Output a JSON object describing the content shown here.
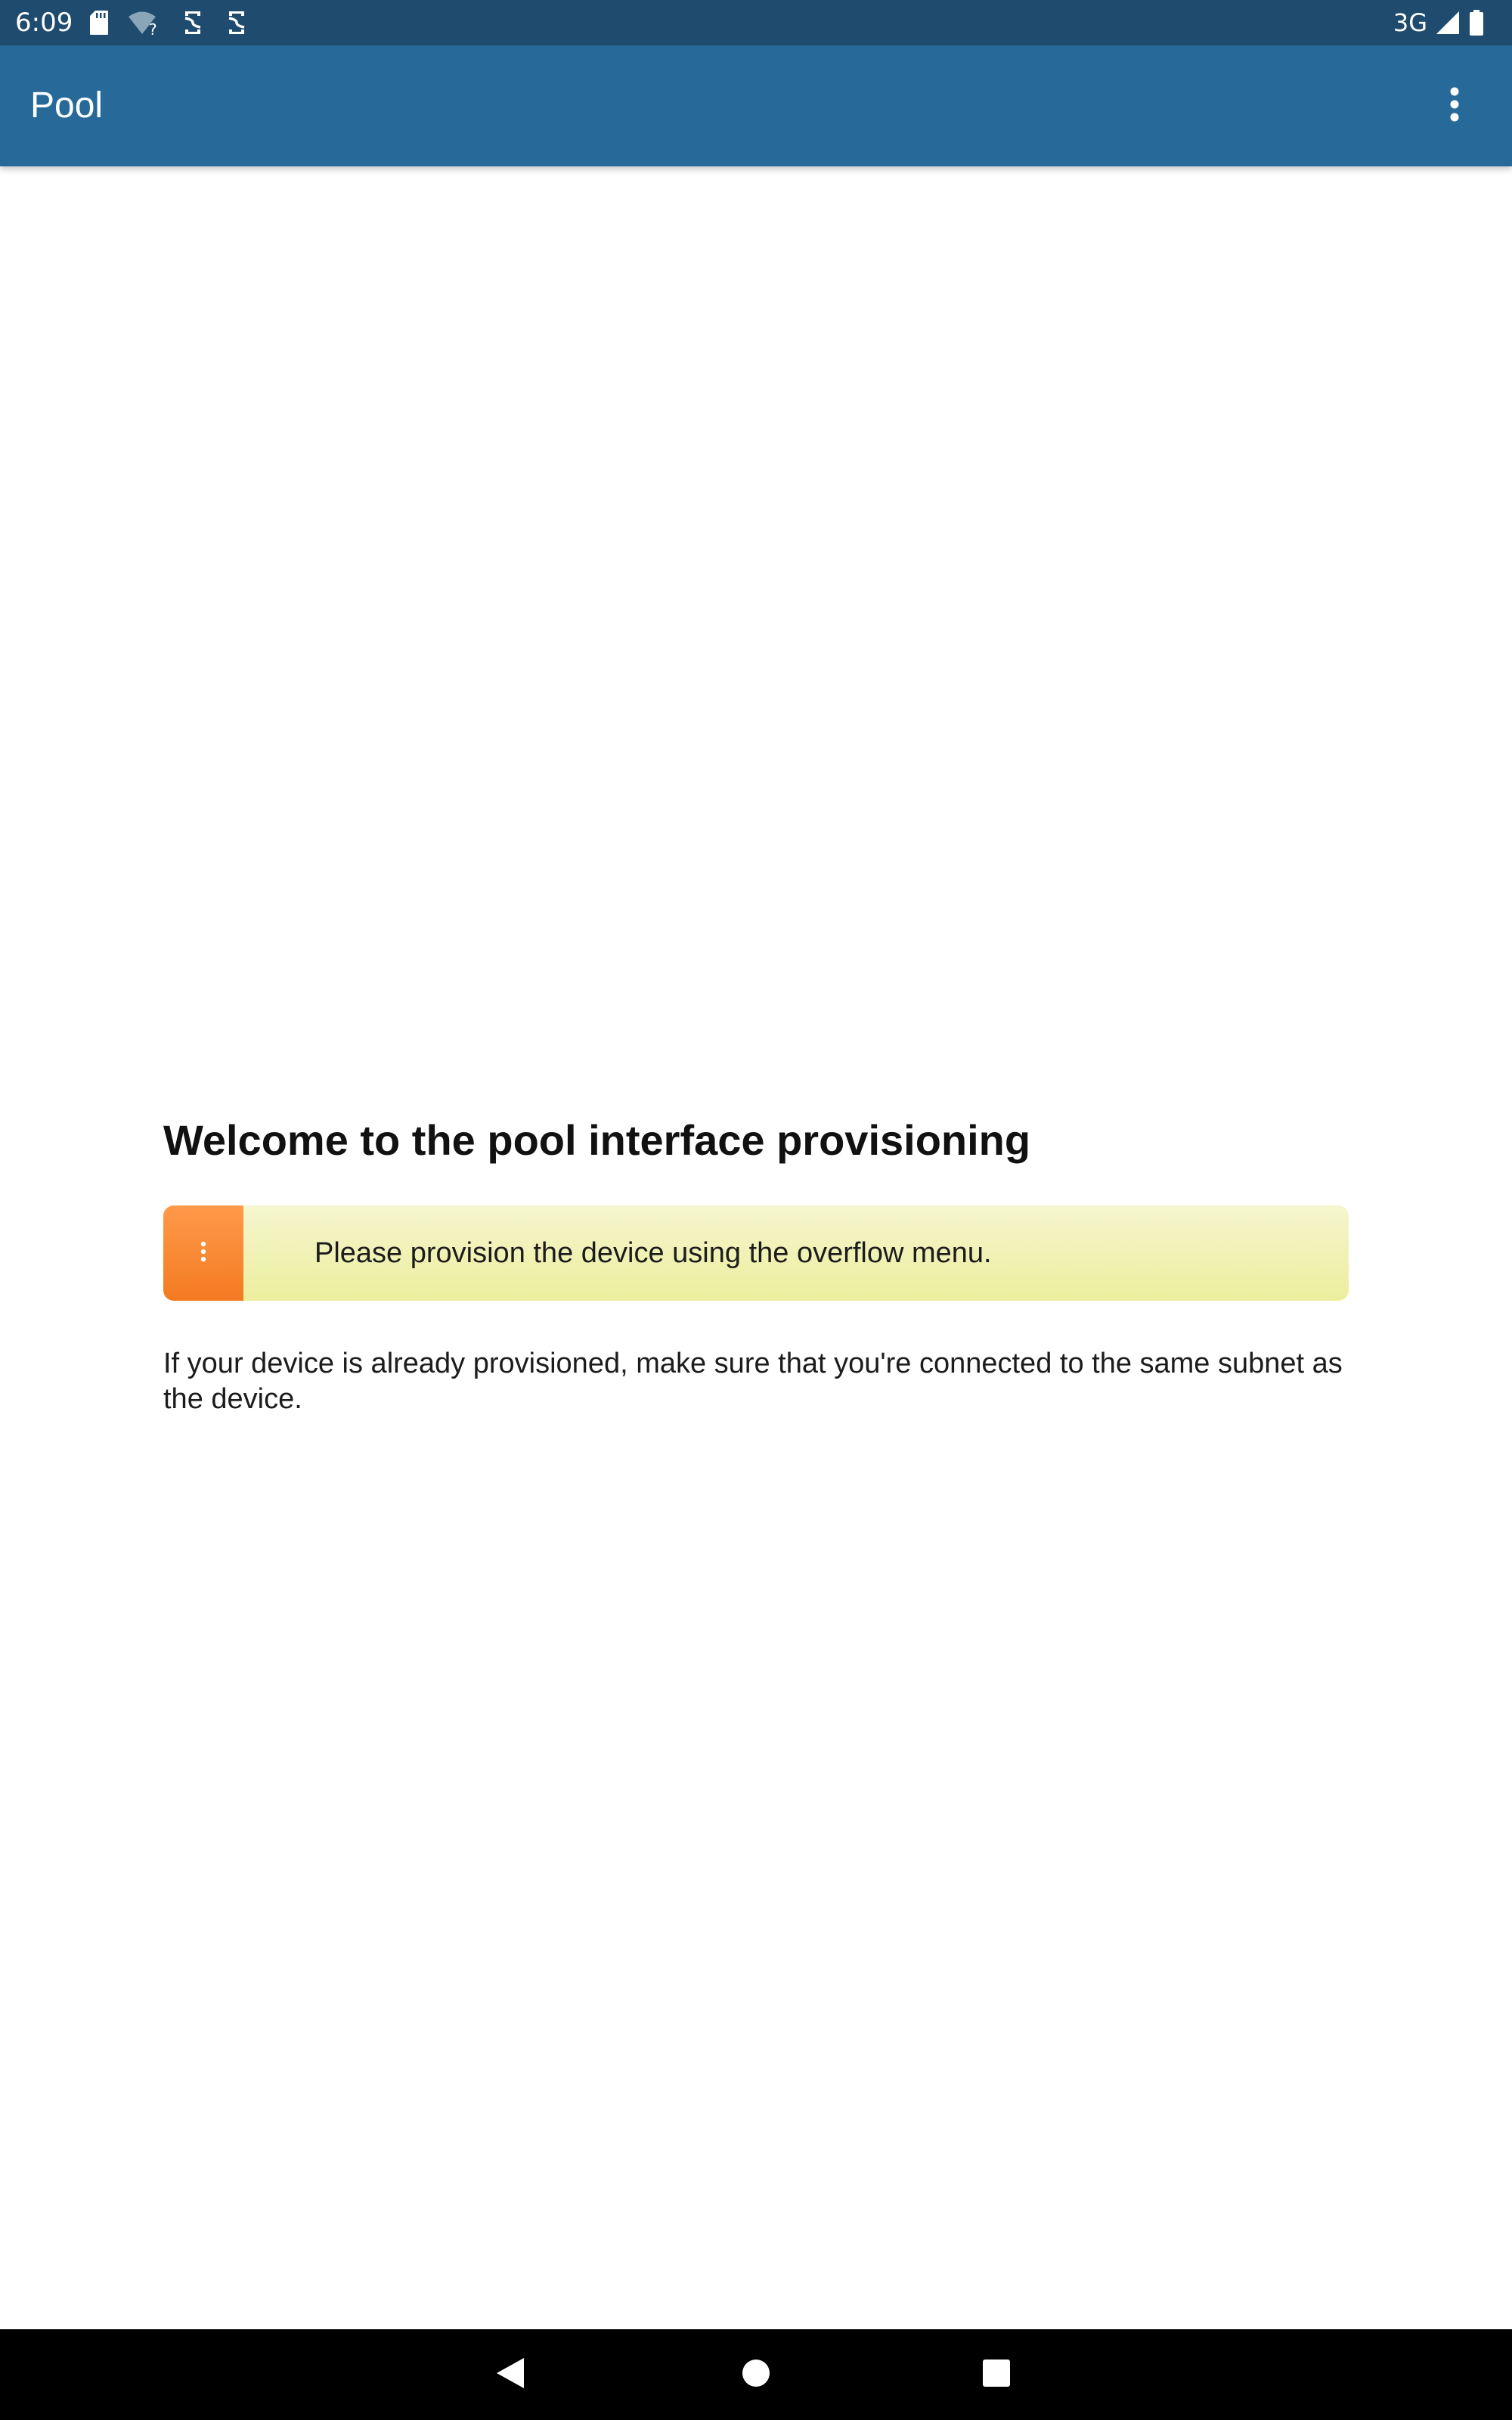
{
  "status_bar": {
    "time": "6:09",
    "network": "3G",
    "icons_left": [
      "sd-card-icon",
      "wifi-question-icon",
      "sync-icon",
      "sync-icon"
    ],
    "icons_right": [
      "signal-icon",
      "battery-icon"
    ]
  },
  "app_bar": {
    "title": "Pool",
    "overflow_icon": "more-vert-icon",
    "color": "#276a99"
  },
  "main": {
    "heading": "Welcome to the pool interface provisioning",
    "banner": {
      "icon": "more-vert-icon",
      "text": "Please provision the device using the overflow menu.",
      "accent_color": "#f37a21",
      "background_color": "#f0f1b0"
    },
    "note": "If your device is already provisioned, make sure that you're connected to the same subnet as the device."
  },
  "nav_bar": {
    "buttons": [
      "back-icon",
      "home-icon",
      "recents-icon"
    ]
  }
}
